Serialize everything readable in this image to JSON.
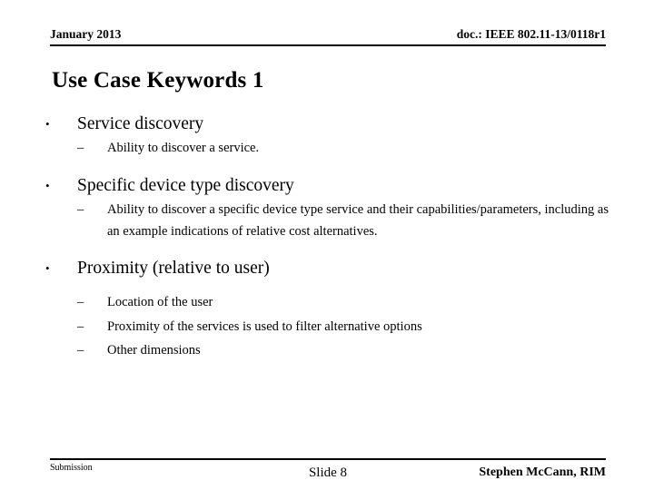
{
  "header": {
    "left": "January 2013",
    "right": "doc.: IEEE 802.11-13/0118r1"
  },
  "title": "Use Case Keywords 1",
  "content": {
    "bullets": [
      {
        "text": "Service discovery",
        "marker": "•",
        "subitems": [
          {
            "marker": "–",
            "text": "Ability to discover a service."
          }
        ]
      },
      {
        "text": "Specific device type discovery",
        "marker": "•",
        "subitems": [
          {
            "marker": "–",
            "text": "Ability to discover a specific device type service and their capabilities/parameters, including as an example indications of relative cost alternatives."
          }
        ]
      },
      {
        "text": "Proximity (relative to user)",
        "marker": "•",
        "subitems": [
          {
            "marker": "–",
            "text": "Location of the user"
          },
          {
            "marker": "–",
            "text": "Proximity of the services is used to filter alternative options"
          },
          {
            "marker": "–",
            "text": "Other dimensions"
          }
        ]
      }
    ]
  },
  "footer": {
    "left": "Submission",
    "center": "Slide 8",
    "right": "Stephen McCann, RIM"
  },
  "colors": {
    "text": "#000000",
    "background": "#ffffff",
    "rule": "#000000"
  }
}
